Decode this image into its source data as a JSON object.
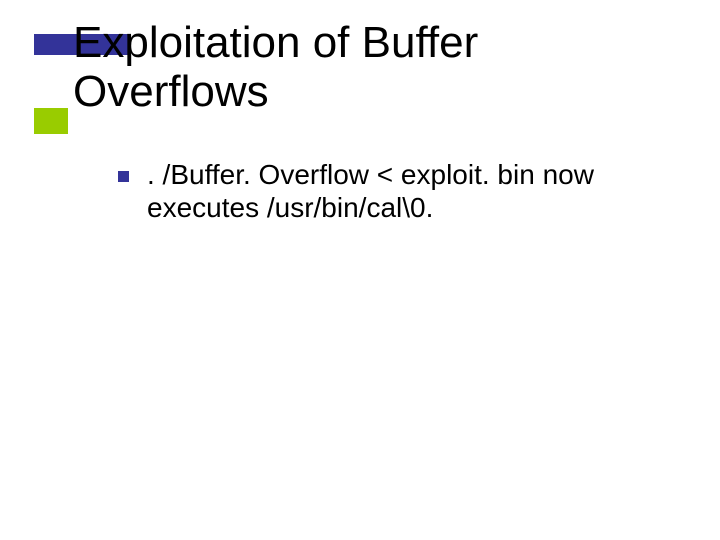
{
  "slide": {
    "title": "Exploitation of Buffer Overflows",
    "bullets": [
      {
        "text": ". /Buffer. Overflow < exploit. bin now executes /usr/bin/cal\\0."
      }
    ]
  }
}
